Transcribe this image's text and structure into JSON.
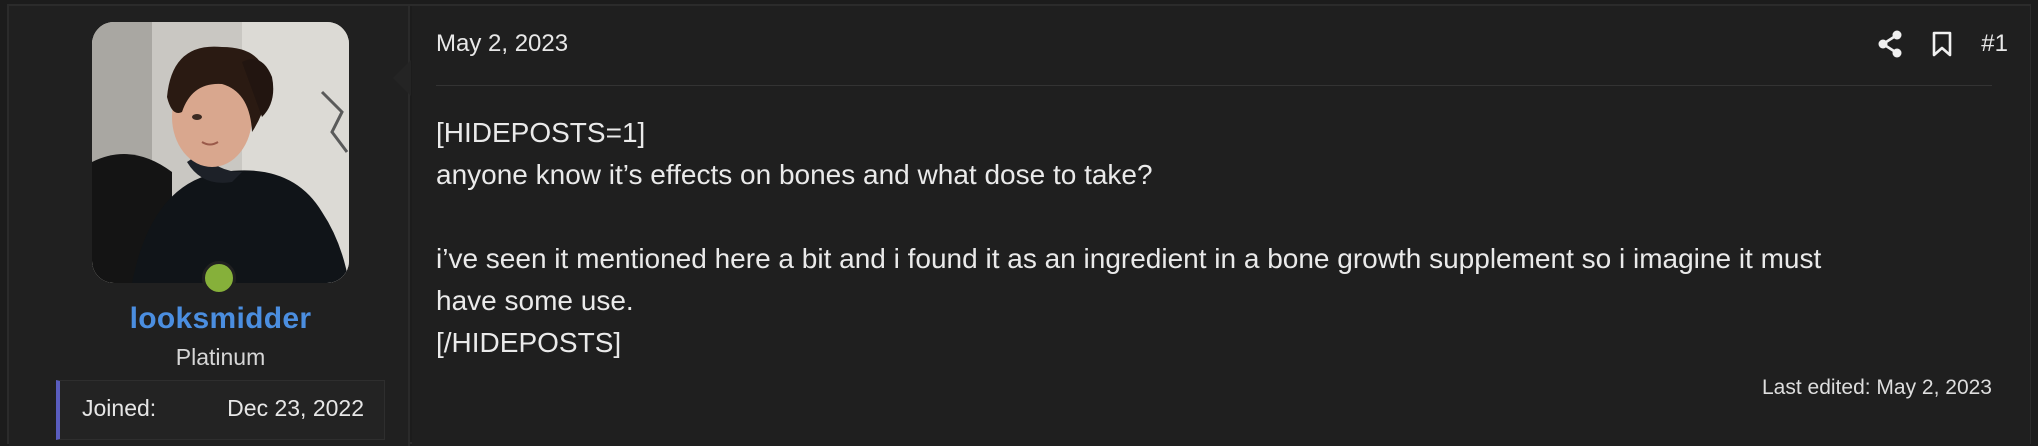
{
  "user": {
    "username": "looksmidder",
    "title": "Platinum",
    "joined_label": "Joined:",
    "joined_value": "Dec 23, 2022",
    "online_color": "#86b03a",
    "username_color": "#4b8ee0"
  },
  "post": {
    "date": "May 2, 2023",
    "number": "#1",
    "actions": [
      {
        "icon": "share-icon"
      },
      {
        "icon": "bookmark-icon"
      }
    ],
    "lines": [
      "[HIDEPOSTS=1]",
      "anyone know it’s effects on bones and what dose to take?",
      "",
      "i’ve seen it mentioned here a bit and i found it as an ingredient in a bone growth supplement so i imagine it must",
      "have some use.",
      "[/HIDEPOSTS]"
    ],
    "last_edited": "Last edited: May 2, 2023"
  }
}
